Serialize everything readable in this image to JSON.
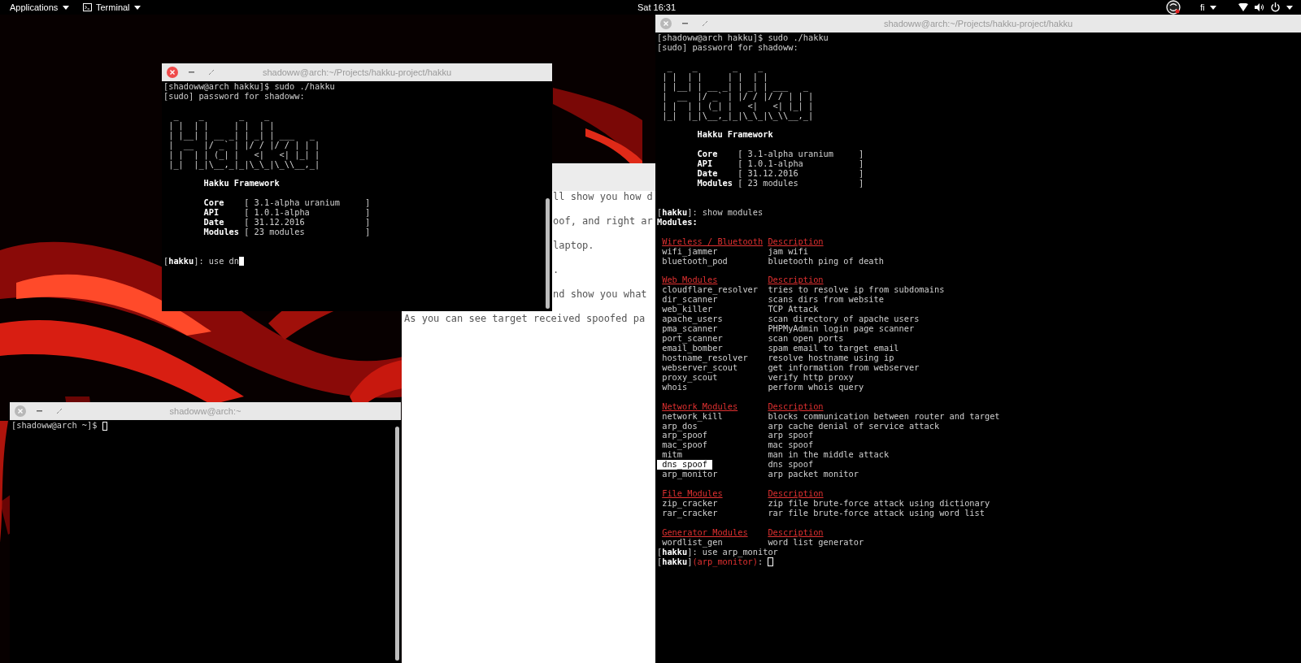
{
  "top_bar": {
    "applications_menu": "Applications",
    "app_menu": "Terminal",
    "clock": "Sat 16:31",
    "keyboard_layout": "fi"
  },
  "editor": {
    "lines": [
      {
        "text": "ll show you how d",
        "start_hidden": true
      },
      {
        "text": "oof, and right ar",
        "start_hidden": true
      },
      {
        "text": "laptop.",
        "start_hidden": true
      },
      {
        "text": ".",
        "start_hidden": true
      },
      {
        "text": "nd show you what",
        "start_hidden": true
      },
      {
        "text": "As you can see target received spoofed pa",
        "start_hidden": false
      }
    ]
  },
  "bottom_terminal": {
    "title": "shadoww@arch:~",
    "active": false,
    "lines": [
      {
        "kind": "plain",
        "text": "[shadoww@arch ~]$",
        "cursor": true
      }
    ]
  },
  "left_terminal": {
    "title": "shadoww@arch:~/Projects/hakku-project/hakku",
    "active": true,
    "lines": [
      {
        "kind": "plain",
        "text": "[shadoww@arch hakku]$ sudo ./hakku"
      },
      {
        "kind": "plain",
        "text": "[sudo] password for shadoww:"
      },
      {
        "kind": "blank"
      },
      {
        "kind": "art",
        "text": "  _    _       _    _"
      },
      {
        "kind": "art",
        "text": " | |  | |     | |  | |"
      },
      {
        "kind": "art",
        "text": " | |__| | __ _| | _| | ___   _"
      },
      {
        "kind": "art",
        "text": " |  __  |/ _` | |/ / |/ / | | |"
      },
      {
        "kind": "art",
        "text": " | |  | | (_| |   <|   <| |_| |"
      },
      {
        "kind": "art",
        "text": " |_|  |_|\\__,_|_|\\_\\_|\\_\\\\__,_|"
      },
      {
        "kind": "blank"
      },
      {
        "kind": "title",
        "text": "Hakku Framework"
      },
      {
        "kind": "blank"
      },
      {
        "kind": "info",
        "key": "Core",
        "value": "[ 3.1-alpha uranium     ]"
      },
      {
        "kind": "info",
        "key": "API",
        "value": "[ 1.0.1-alpha           ]"
      },
      {
        "kind": "info",
        "key": "Date",
        "value": "[ 31.12.2016            ]"
      },
      {
        "kind": "info",
        "key": "Modules",
        "value": "[ 23 modules            ]"
      },
      {
        "kind": "blank"
      },
      {
        "kind": "blank"
      },
      {
        "kind": "prompt",
        "prompt": "[**hakku**]: use dn",
        "cursor": true
      }
    ]
  },
  "right_terminal": {
    "title": "shadoww@arch:~/Projects/hakku-project/hakku",
    "active": false,
    "lines": [
      {
        "kind": "plain",
        "text": "[shadoww@arch hakku]$ sudo ./hakku"
      },
      {
        "kind": "plain",
        "text": "[sudo] password for shadoww:"
      },
      {
        "kind": "blank"
      },
      {
        "kind": "art",
        "text": "  _    _       _    _"
      },
      {
        "kind": "art",
        "text": " | |  | |     | |  | |"
      },
      {
        "kind": "art",
        "text": " | |__| | __ _| | _| | ___   _"
      },
      {
        "kind": "art",
        "text": " |  __  |/ _` | |/ / |/ / | | |"
      },
      {
        "kind": "art",
        "text": " | |  | | (_| |   <|   <| |_| |"
      },
      {
        "kind": "art",
        "text": " |_|  |_|\\__,_|_|\\_\\_|\\_\\\\__,_|"
      },
      {
        "kind": "blank"
      },
      {
        "kind": "title",
        "text": "Hakku Framework"
      },
      {
        "kind": "blank"
      },
      {
        "kind": "info",
        "key": "Core",
        "value": "[ 3.1-alpha uranium     ]"
      },
      {
        "kind": "info",
        "key": "API",
        "value": "[ 1.0.1-alpha           ]"
      },
      {
        "kind": "info",
        "key": "Date",
        "value": "[ 31.12.2016            ]"
      },
      {
        "kind": "info",
        "key": "Modules",
        "value": "[ 23 modules            ]"
      },
      {
        "kind": "blank"
      },
      {
        "kind": "blank"
      },
      {
        "kind": "prompt",
        "prompt": "[**hakku**]: show modules"
      },
      {
        "kind": "label",
        "text": "Modules:"
      },
      {
        "kind": "blank"
      },
      {
        "kind": "section",
        "name": "Wireless / Bluetooth",
        "description": "Description"
      },
      {
        "kind": "module",
        "name": "wifi_jammer",
        "description": "jam wifi",
        "selected": false
      },
      {
        "kind": "module",
        "name": "bluetooth_pod",
        "description": "bluetooth ping of death",
        "selected": false
      },
      {
        "kind": "blank"
      },
      {
        "kind": "section",
        "name": "Web Modules",
        "description": "Description"
      },
      {
        "kind": "module",
        "name": "cloudflare_resolver",
        "description": "tries to resolve ip from subdomains",
        "selected": false
      },
      {
        "kind": "module",
        "name": "dir_scanner",
        "description": "scans dirs from website",
        "selected": false
      },
      {
        "kind": "module",
        "name": "web_killer",
        "description": "TCP Attack",
        "selected": false
      },
      {
        "kind": "module",
        "name": "apache_users",
        "description": "scan directory of apache users",
        "selected": false
      },
      {
        "kind": "module",
        "name": "pma_scanner",
        "description": "PHPMyAdmin login page scanner",
        "selected": false
      },
      {
        "kind": "module",
        "name": "port_scanner",
        "description": "scan open ports",
        "selected": false
      },
      {
        "kind": "module",
        "name": "email_bomber",
        "description": "spam email to target email",
        "selected": false
      },
      {
        "kind": "module",
        "name": "hostname_resolver",
        "description": "resolve hostname using ip",
        "selected": false
      },
      {
        "kind": "module",
        "name": "webserver_scout",
        "description": "get information from webserver",
        "selected": false
      },
      {
        "kind": "module",
        "name": "proxy_scout",
        "description": "verify http proxy",
        "selected": false
      },
      {
        "kind": "module",
        "name": "whois",
        "description": "perform whois query",
        "selected": false
      },
      {
        "kind": "blank"
      },
      {
        "kind": "section",
        "name": "Network Modules",
        "description": "Description"
      },
      {
        "kind": "module",
        "name": "network_kill",
        "description": "blocks communication between router and target",
        "selected": false
      },
      {
        "kind": "module",
        "name": "arp_dos",
        "description": "arp cache denial of service attack",
        "selected": false
      },
      {
        "kind": "module",
        "name": "arp_spoof",
        "description": "arp spoof",
        "selected": false
      },
      {
        "kind": "module",
        "name": "mac_spoof",
        "description": "mac spoof",
        "selected": false
      },
      {
        "kind": "module",
        "name": "mitm",
        "description": "man in the middle attack",
        "selected": false
      },
      {
        "kind": "module",
        "name": "dns_spoof",
        "description": "dns spoof",
        "selected": true
      },
      {
        "kind": "module",
        "name": "arp_monitor",
        "description": "arp packet monitor",
        "selected": false
      },
      {
        "kind": "blank"
      },
      {
        "kind": "section",
        "name": "File Modules",
        "description": "Description"
      },
      {
        "kind": "module",
        "name": "zip_cracker",
        "description": "zip file brute-force attack using dictionary",
        "selected": false
      },
      {
        "kind": "module",
        "name": "rar_cracker",
        "description": "rar file brute-force attack using word list",
        "selected": false
      },
      {
        "kind": "blank"
      },
      {
        "kind": "section",
        "name": "Generator Modules",
        "description": "Description"
      },
      {
        "kind": "module",
        "name": "wordlist_gen",
        "description": "word list generator",
        "selected": false
      },
      {
        "kind": "prompt",
        "prompt": "[**hakku**]: use arp_monitor"
      },
      {
        "kind": "prompt",
        "prompt": "[**hakku**]",
        "module": "(arp_monitor)",
        "text": ":",
        "cursor": true
      }
    ]
  }
}
